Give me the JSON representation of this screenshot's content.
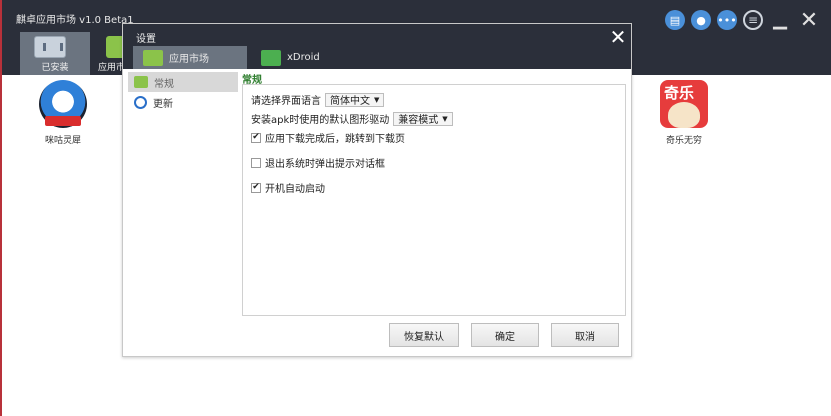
{
  "app": {
    "title": "麒卓应用市场 v1.0 Beta1",
    "tabs": [
      {
        "label": "已安装",
        "icon": "installed-apps-icon"
      },
      {
        "label": "应用市",
        "icon": "app-market-icon"
      }
    ],
    "header_icons": [
      "message-icon",
      "user-icon",
      "chat-icon",
      "menu-icon",
      "minimize-icon",
      "close-icon"
    ],
    "apps": [
      {
        "name": "咪咕灵犀",
        "icon": "migu-lingxi-icon"
      },
      {
        "name": "奇乐无穷",
        "icon": "qile-icon"
      }
    ],
    "qile_icon_text": "奇乐"
  },
  "dialog": {
    "title": "设置",
    "close_glyph": "✕",
    "tabs": [
      {
        "label": "应用市场",
        "icon": "app-market-icon"
      },
      {
        "label": "xDroid",
        "icon": "xdroid-icon"
      }
    ],
    "nav": [
      {
        "label": "常规",
        "icon": "general-icon"
      },
      {
        "label": "更新",
        "icon": "update-icon"
      }
    ],
    "section_title": "常规",
    "language_label": "请选择界面语言",
    "language_value": "简体中文",
    "driver_label": "安装apk时使用的默认图形驱动",
    "driver_value": "兼容模式",
    "options": [
      {
        "label": "应用下载完成后，跳转到下载页",
        "checked": true
      },
      {
        "label": "退出系统时弹出提示对话框",
        "checked": false
      },
      {
        "label": "开机自动启动",
        "checked": true
      }
    ],
    "buttons": {
      "reset": "恢复默认",
      "ok": "确定",
      "cancel": "取消"
    }
  },
  "colors": {
    "titlebar": "#2b2f3a",
    "active_tab": "#6b7480",
    "section_title": "#2d7d2d",
    "accent_red": "#b8313a"
  }
}
